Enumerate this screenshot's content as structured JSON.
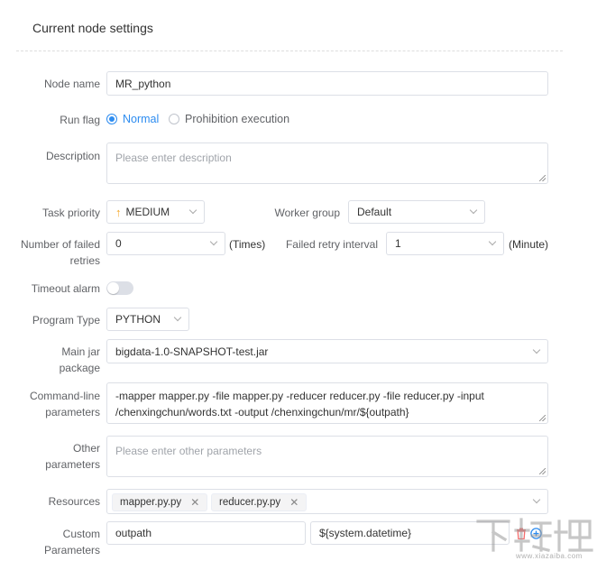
{
  "header": {
    "title": "Current node settings"
  },
  "fields": {
    "node_name": {
      "label": "Node name",
      "value": "MR_python"
    },
    "run_flag": {
      "label": "Run flag",
      "options": [
        {
          "label": "Normal",
          "selected": true
        },
        {
          "label": "Prohibition execution",
          "selected": false
        }
      ]
    },
    "description": {
      "label": "Description",
      "placeholder": "Please enter description"
    },
    "task_priority": {
      "label": "Task priority",
      "value": "MEDIUM"
    },
    "worker_group": {
      "label": "Worker group",
      "value": "Default"
    },
    "failed_retries": {
      "label_line1": "Number of failed",
      "label_line2": "retries",
      "value": "0",
      "unit": "(Times)"
    },
    "retry_interval": {
      "label": "Failed retry interval",
      "value": "1",
      "unit": "(Minute)"
    },
    "timeout_alarm": {
      "label": "Timeout alarm",
      "enabled": false
    },
    "program_type": {
      "label": "Program Type",
      "value": "PYTHON"
    },
    "main_jar": {
      "label_line1": "Main jar",
      "label_line2": "package",
      "value": "bigdata-1.0-SNAPSHOT-test.jar"
    },
    "cmd_params": {
      "label_line1": "Command-line",
      "label_line2": "parameters",
      "value_line1": "-mapper mapper.py -file mapper.py -reducer reducer.py -file reducer.py -input",
      "value_line2": "/chenxingchun/words.txt -output /chenxingchun/mr/${outpath}"
    },
    "other_params": {
      "label_line1": "Other",
      "label_line2": "parameters",
      "placeholder": "Please enter other parameters"
    },
    "resources": {
      "label": "Resources",
      "tags": [
        "mapper.py.py",
        "reducer.py.py"
      ]
    },
    "custom_params": {
      "label_line1": "Custom",
      "label_line2": "Parameters",
      "prop": "outpath",
      "value": "${system.datetime}"
    }
  },
  "colors": {
    "accent": "#2d8cf0",
    "priority_arrow": "#f5a623",
    "delete": "#f56c6c"
  },
  "watermark": {
    "brand": "下载吧",
    "site": "www.xiazaiba.com"
  }
}
